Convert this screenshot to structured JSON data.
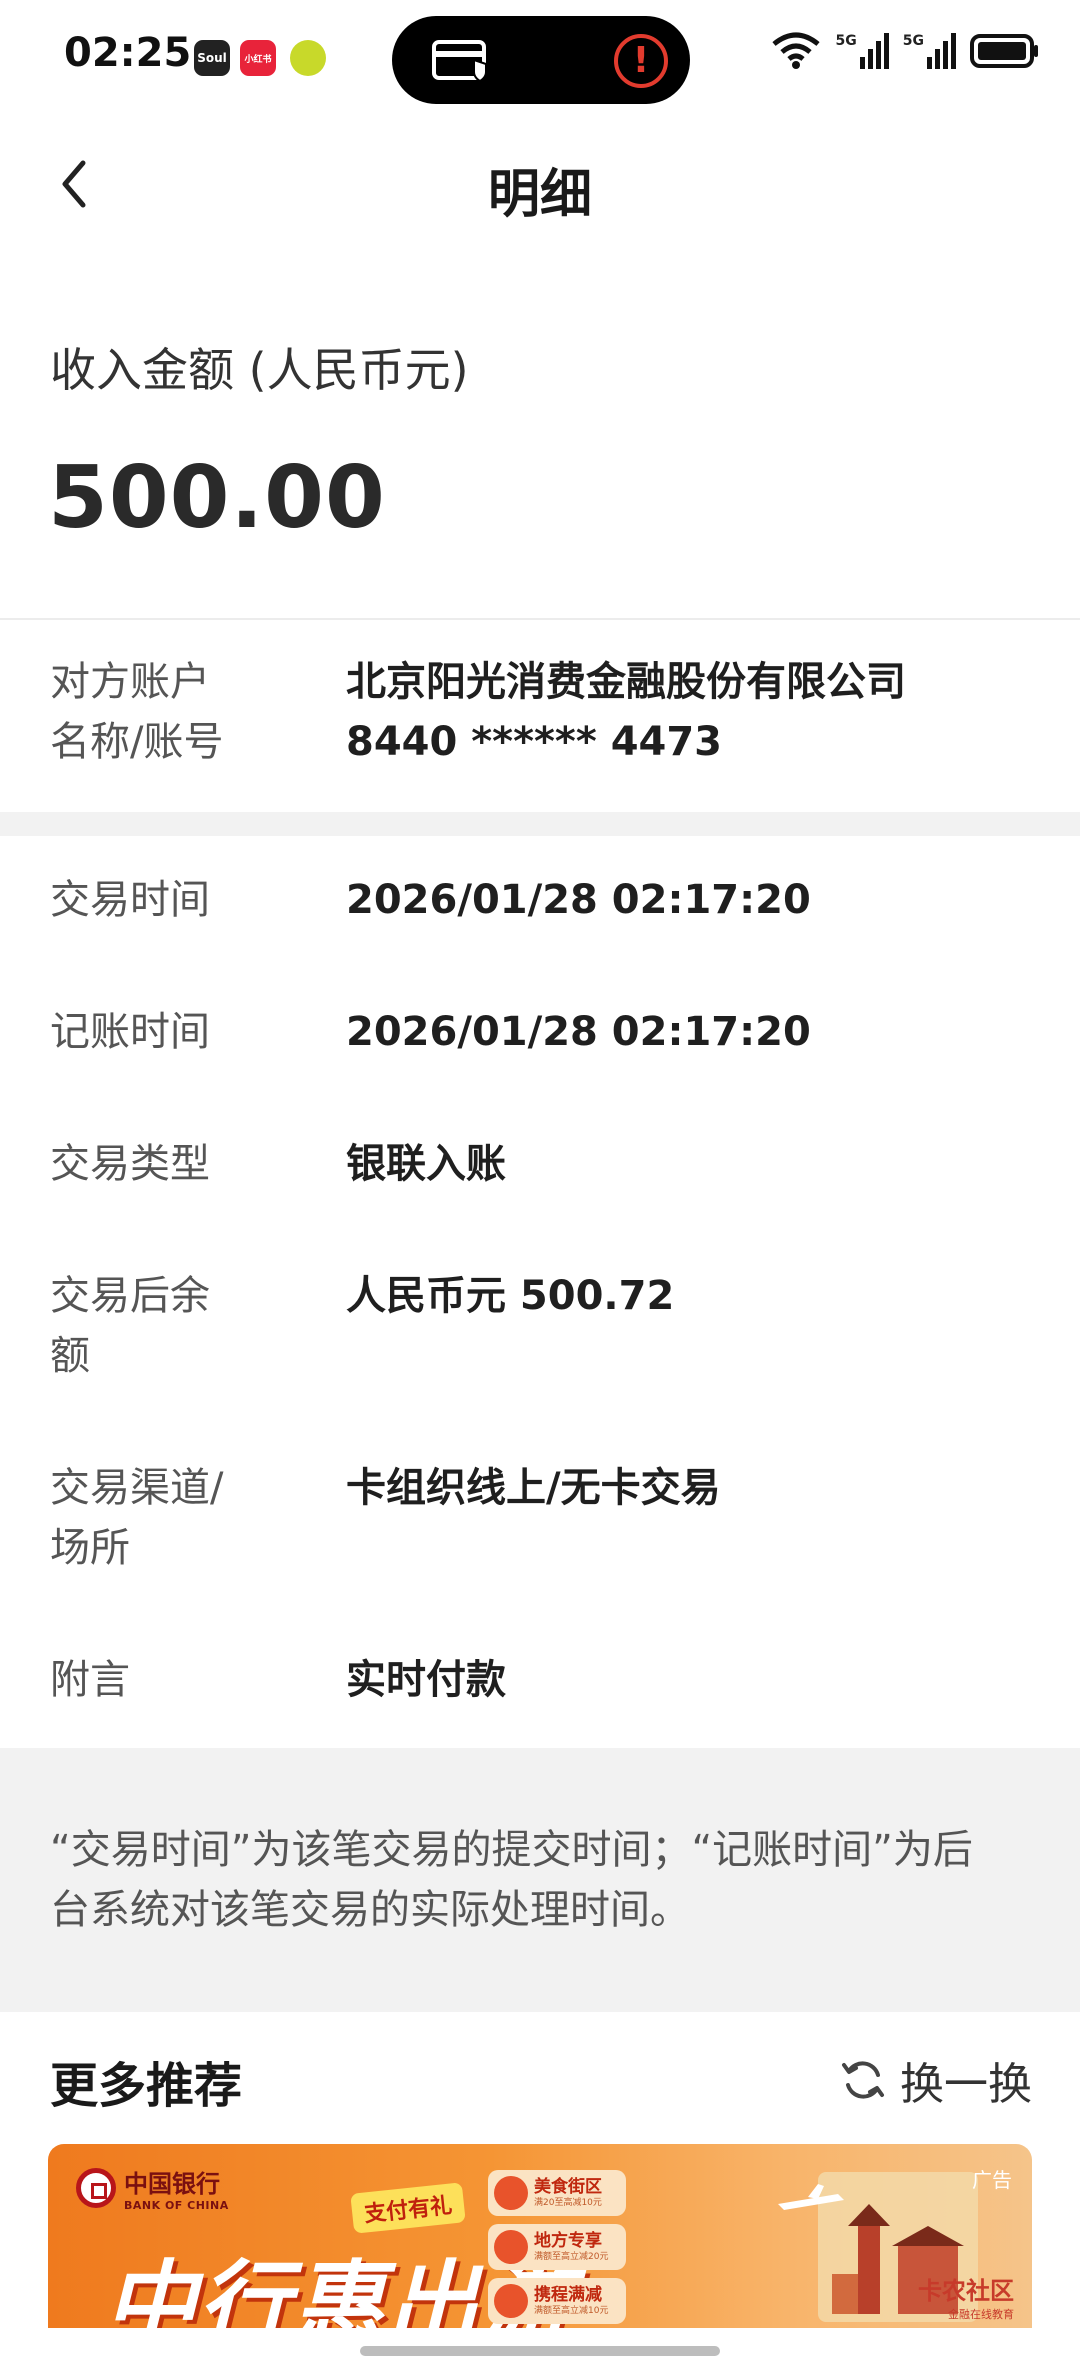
{
  "status_bar": {
    "time": "02:25",
    "apps": [
      "Soul",
      "小红书",
      ""
    ],
    "network_1": "5G",
    "network_2": "5G"
  },
  "nav": {
    "title": "明细",
    "back_icon": "chevron-left-icon"
  },
  "amount": {
    "label": "收入金额 (人民币元)",
    "value": "500.00"
  },
  "counterparty": {
    "key_line1": "对方账户",
    "key_line2": "名称/账号",
    "name": "北京阳光消费金融股份有限公司",
    "account": "8440 ****** 4473"
  },
  "details": [
    {
      "key": "交易时间",
      "value": "2026/01/28 02:17:20"
    },
    {
      "key": "记账时间",
      "value": "2026/01/28 02:17:20"
    },
    {
      "key": "交易类型",
      "value": "银联入账"
    },
    {
      "key": "交易后余额",
      "value": "人民币元 500.72"
    },
    {
      "key": "交易渠道/场所",
      "value": "卡组织线上/无卡交易"
    },
    {
      "key": "附言",
      "value": "实时付款"
    }
  ],
  "note": "“交易时间”为该笔交易的提交时间；“记账时间”为后台系统对该笔交易的实际处理时间。",
  "recommend": {
    "title": "更多推荐",
    "swap_label": "换一换"
  },
  "banner": {
    "bank_cn": "中国银行",
    "bank_en": "BANK OF CHINA",
    "slogan": "中行惠出游",
    "pill": "支付有礼",
    "offers": [
      {
        "title": "美食街区",
        "sub": "满20至高减10元"
      },
      {
        "title": "地方专享",
        "sub": "满额至高立减20元"
      },
      {
        "title": "携程满减",
        "sub": "满额至高立减10元"
      }
    ],
    "ad_tag": "广告",
    "watermark_title": "卡农社区",
    "watermark_sub": "金融在线教育"
  },
  "colors": {
    "accent_red": "#e23b2e",
    "banner_orange": "#ef7a1e",
    "band_gray": "#f2f2f2"
  }
}
